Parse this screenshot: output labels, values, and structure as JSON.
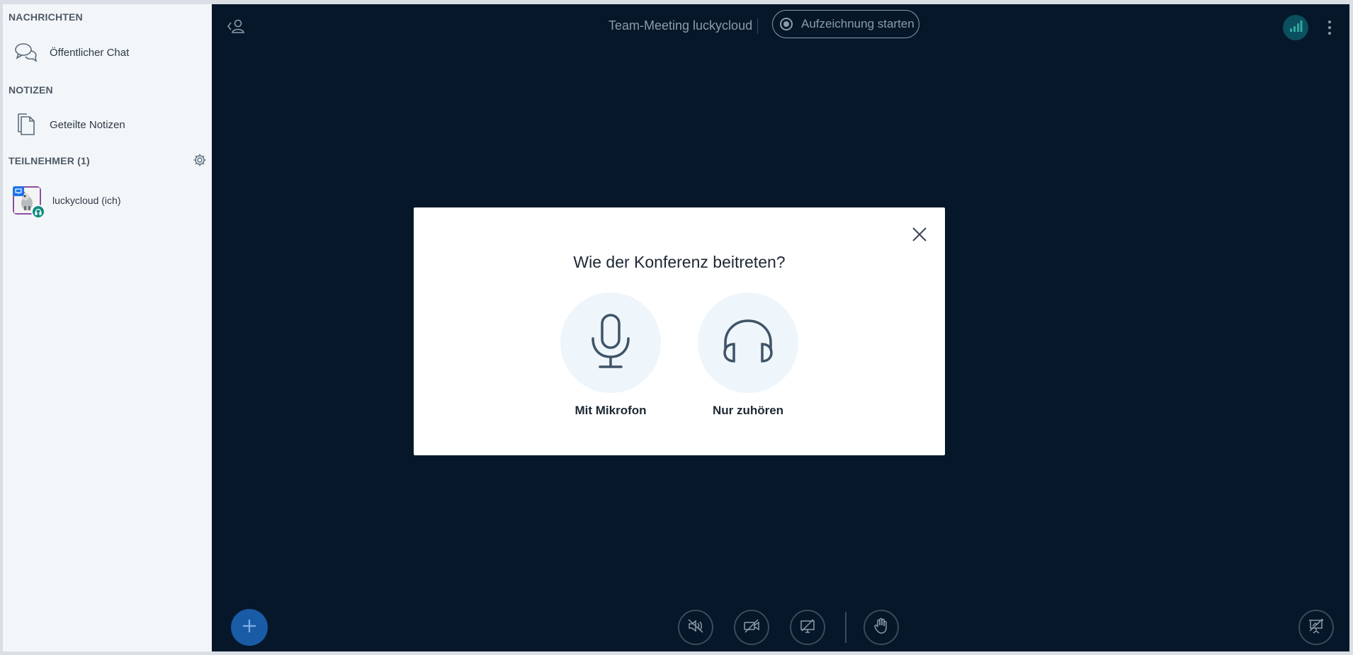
{
  "sidebar": {
    "messages_heading": "NACHRICHTEN",
    "public_chat_label": "Öffentlicher Chat",
    "notes_heading": "NOTIZEN",
    "shared_notes_label": "Geteilte Notizen",
    "participants_heading": "TEILNEHMER (1)",
    "participants": [
      {
        "name": "luckycloud (ich)"
      }
    ]
  },
  "header": {
    "meeting_title": "Team-Meeting luckycloud",
    "record_label": "Aufzeichnung starten"
  },
  "modal": {
    "title": "Wie der Konferenz beitreten?",
    "options": [
      {
        "label": "Mit Mikrofon",
        "icon": "microphone-icon"
      },
      {
        "label": "Nur zuhören",
        "icon": "headphones-icon"
      }
    ]
  },
  "colors": {
    "main_bg": "#06172a",
    "sidebar_bg": "#f3f6f9",
    "accent_blue": "#1a5ba6",
    "connection_teal": "#0c4f5e"
  }
}
